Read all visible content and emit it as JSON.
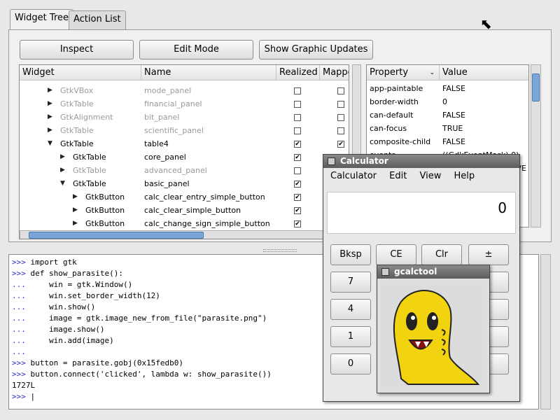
{
  "tabs": [
    {
      "label": "Widget Tree"
    },
    {
      "label": "Action List"
    }
  ],
  "toolbar": {
    "inspect": "Inspect",
    "edit_mode": "Edit Mode",
    "show_updates": "Show Graphic Updates"
  },
  "tree": {
    "headers": {
      "widget": "Widget",
      "name": "Name",
      "realized": "Realized",
      "mapped": "Mappe"
    },
    "rows": [
      {
        "widget": "GtkVBox",
        "name": "mode_panel",
        "dim": true,
        "expander": "▶",
        "realized": false,
        "mapped": false
      },
      {
        "widget": "GtkTable",
        "name": "financial_panel",
        "dim": true,
        "expander": "▶",
        "realized": false,
        "mapped": false
      },
      {
        "widget": "GtkAlignment",
        "name": "bit_panel",
        "dim": true,
        "expander": "▶",
        "realized": false,
        "mapped": false
      },
      {
        "widget": "GtkTable",
        "name": "scientific_panel",
        "dim": true,
        "expander": "▶",
        "realized": false,
        "mapped": false
      },
      {
        "widget": "GtkTable",
        "name": "table4",
        "dim": false,
        "expander": "▼",
        "realized": true,
        "mapped": true
      },
      {
        "widget": "GtkTable",
        "name": "core_panel",
        "dim": false,
        "expander": "▶",
        "realized": true,
        "mapped": true
      },
      {
        "widget": "GtkTable",
        "name": "advanced_panel",
        "dim": true,
        "expander": "▶",
        "realized": false,
        "mapped": false
      },
      {
        "widget": "GtkTable",
        "name": "basic_panel",
        "dim": false,
        "expander": "▼",
        "realized": true,
        "mapped": true
      },
      {
        "widget": "GtkButton",
        "name": "calc_clear_entry_simple_button",
        "dim": false,
        "expander": "▶",
        "realized": true,
        "mapped": true
      },
      {
        "widget": "GtkButton",
        "name": "calc_clear_simple_button",
        "dim": false,
        "expander": "▶",
        "realized": true,
        "mapped": true
      },
      {
        "widget": "GtkButton",
        "name": "calc_change_sign_simple_button",
        "dim": false,
        "expander": "▶",
        "realized": true,
        "mapped": true
      }
    ]
  },
  "props": {
    "headers": {
      "property": "Property",
      "value": "Value"
    },
    "rows": [
      {
        "property": "app-paintable",
        "value": "FALSE"
      },
      {
        "property": "border-width",
        "value": "0"
      },
      {
        "property": "can-default",
        "value": "FALSE"
      },
      {
        "property": "can-focus",
        "value": "TRUE"
      },
      {
        "property": "composite-child",
        "value": "FALSE"
      },
      {
        "property": "events",
        "value": "((GdkEventMask) 0)"
      },
      {
        "property": "extension-events",
        "value": "GDK_EXTENSION_EVE"
      }
    ]
  },
  "console": {
    "lines": [
      {
        "prompt": ">>> ",
        "text": "import gtk"
      },
      {
        "prompt": ">>> ",
        "text": "def show_parasite():"
      },
      {
        "prompt": "... ",
        "text": "    win = gtk.Window()"
      },
      {
        "prompt": "... ",
        "text": "    win.set_border_width(12)"
      },
      {
        "prompt": "... ",
        "text": "    win.show()"
      },
      {
        "prompt": "... ",
        "text": "    image = gtk.image_new_from_file(\"parasite.png\")"
      },
      {
        "prompt": "... ",
        "text": "    image.show()"
      },
      {
        "prompt": "... ",
        "text": "    win.add(image)"
      },
      {
        "prompt": "... ",
        "text": ""
      },
      {
        "prompt": ">>> ",
        "text": "button = parasite.gobj(0x15fedb0)"
      },
      {
        "prompt": ">>> ",
        "text": "button.connect('clicked', lambda w: show_parasite())"
      },
      {
        "prompt": "",
        "text": "1727L"
      },
      {
        "prompt": ">>> ",
        "text": "|"
      }
    ]
  },
  "calculator": {
    "title": "Calculator",
    "menu": [
      "Calculator",
      "Edit",
      "View",
      "Help"
    ],
    "display": "0",
    "buttons": [
      "Bksp",
      "CE",
      "Clr",
      "±",
      "7",
      "4",
      "1",
      "0"
    ]
  },
  "gcalctool": {
    "title": "gcalctool"
  }
}
